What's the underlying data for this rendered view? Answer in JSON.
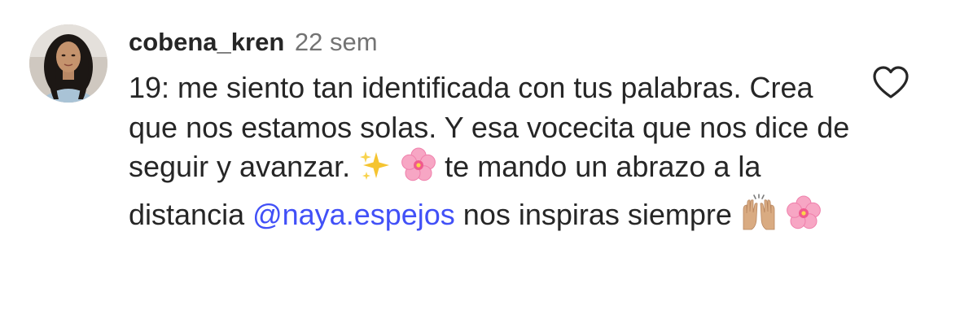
{
  "comment": {
    "username": "cobena_kren",
    "timestamp": "22 sem",
    "text_part1": "19: me siento tan identificada con tus palabras. Crea que nos estamos solas. Y esa vocecita que nos dice de seguir y avanzar. ",
    "emoji_1": "sparkles",
    "emoji_2": "cherry-blossom",
    "text_part2": " te mando un abrazo a la distancia ",
    "mention": "@naya.espejos",
    "text_part3": " nos inspiras siempre ",
    "emoji_3": "raising-hands",
    "emoji_4": "cherry-blossom",
    "like_icon": "heart-outline-icon",
    "avatar_icon": "profile-photo"
  },
  "colors": {
    "text": "#262626",
    "timestamp": "#737373",
    "mention": "#4150f7",
    "icon": "#262626"
  }
}
